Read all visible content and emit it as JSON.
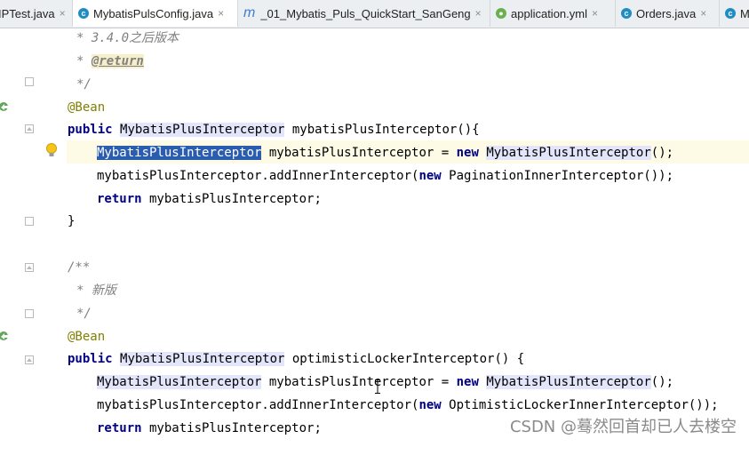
{
  "tabs": [
    {
      "label": "IPTest.java",
      "icon": "java-class-icon"
    },
    {
      "label": "MybatisPulsConfig.java",
      "icon": "java-class-icon",
      "active": true
    },
    {
      "label": "_01_Mybatis_Puls_QuickStart_SanGeng",
      "icon": "module-m-icon"
    },
    {
      "label": "application.yml",
      "icon": "yml-icon"
    },
    {
      "label": "Orders.java",
      "icon": "java-class-icon"
    },
    {
      "label": "M",
      "icon": "java-class-icon"
    }
  ],
  "close_glyph": "×",
  "code": {
    "l1": "* 3.4.0之后版本",
    "l2_star": "* ",
    "l2_tag": "@return",
    "l3": "*/",
    "l4": "@Bean",
    "l5_kw": "public",
    "l5_type": "MybatisPlusInterceptor",
    "l5_rest": " mybatisPlusInterceptor(){",
    "l6_sel": "MybatisPlusInterceptor",
    "l6_mid": " mybatisPlusInterceptor = ",
    "l6_kw": "new",
    "l6_type": "MybatisPlusInterceptor",
    "l6_end": "();",
    "l7_a": "mybatisPlusInterceptor.addInnerInterceptor(",
    "l7_kw": "new",
    "l7_b": " PaginationInnerInterceptor());",
    "l8_kw": "return",
    "l8_rest": " mybatisPlusInterceptor;",
    "l9": "}",
    "l10": "/**",
    "l11": "* 新版",
    "l12": "*/",
    "l13": "@Bean",
    "l14_kw": "public",
    "l14_type": "MybatisPlusInterceptor",
    "l14_rest": " optimisticLockerInterceptor() {",
    "l15_type1": "MybatisPlusInterceptor",
    "l15_mid": " mybatisPlusInterceptor = ",
    "l15_kw": "new",
    "l15_type2": "MybatisPlusInterceptor",
    "l15_end": "();",
    "l16_a": "mybatisPlusInterceptor.addInnerInterceptor(",
    "l16_kw": "new",
    "l16_b": " OptimisticLockerInnerInterceptor());",
    "l17_kw": "return",
    "l17_rest": " mybatisPlusInterceptor;"
  },
  "watermark": "CSDN @蓦然回首却已人去楼空",
  "colors": {
    "keyword": "#000080",
    "annotation": "#808000",
    "comment": "#808080",
    "selection": "#2a5db0",
    "identifier_highlight": "#e3e6fb",
    "caret_line": "#fdfbe6"
  }
}
